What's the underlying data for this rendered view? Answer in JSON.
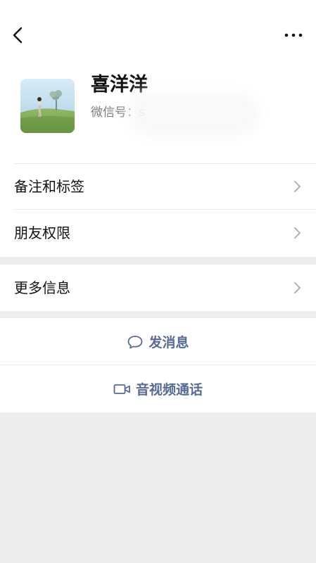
{
  "navbar": {
    "back_icon": "chevron-left-icon",
    "more_icon": "ellipsis-icon"
  },
  "profile": {
    "avatar_description": "girl-in-field-avatar",
    "name": "喜洋洋",
    "wechat_id": "微信号：s"
  },
  "menu": {
    "items": [
      {
        "label": "备注和标签"
      },
      {
        "label": "朋友权限"
      }
    ],
    "more_info": {
      "label": "更多信息"
    }
  },
  "actions": {
    "message": {
      "label": "发消息",
      "icon": "chat-bubble-icon"
    },
    "video_call": {
      "label": "音视频通话",
      "icon": "video-camera-icon"
    }
  },
  "colors": {
    "accent": "#576b95",
    "background": "#ededed",
    "card": "#ffffff"
  }
}
